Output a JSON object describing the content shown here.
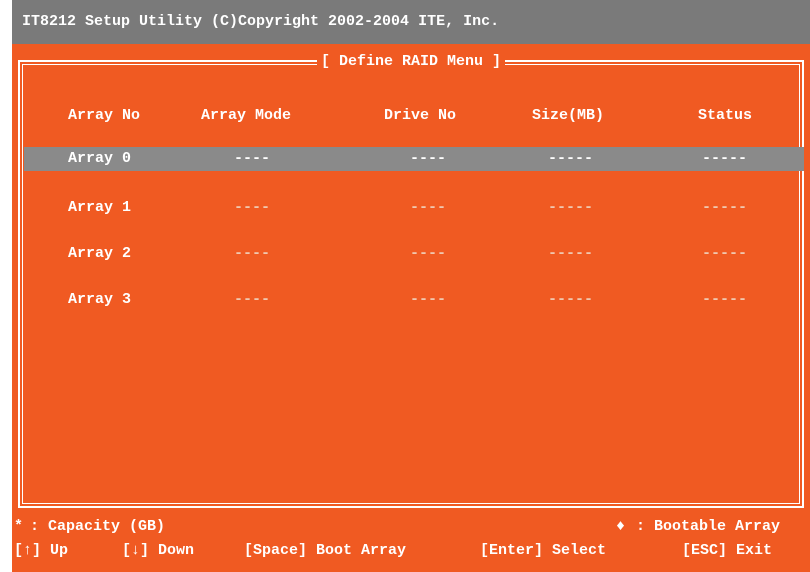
{
  "title_bar": "IT8212 Setup Utility (C)Copyright 2002-2004 ITE, Inc.",
  "menu_title": "[ Define RAID Menu ]",
  "columns": [
    "Array No",
    "Array Mode",
    "Drive No",
    "Size(MB)",
    "Status"
  ],
  "rows": [
    {
      "array_no": "Array 0",
      "mode": "----",
      "drive": "----",
      "size": "-----",
      "status": "-----"
    },
    {
      "array_no": "Array 1",
      "mode": "----",
      "drive": "----",
      "size": "-----",
      "status": "-----"
    },
    {
      "array_no": "Array 2",
      "mode": "----",
      "drive": "----",
      "size": "-----",
      "status": "-----"
    },
    {
      "array_no": "Array 3",
      "mode": "----",
      "drive": "----",
      "size": "-----",
      "status": "-----"
    }
  ],
  "selected_row": 0,
  "legend": {
    "capacity_symbol": "*",
    "capacity_text": ": Capacity (GB)",
    "bootable_symbol": "♦",
    "bootable_text": ": Bootable Array"
  },
  "keys": {
    "up": "[↑] Up",
    "down": "[↓] Down",
    "space": "[Space] Boot Array",
    "enter": "[Enter] Select",
    "esc": "[ESC] Exit"
  },
  "colors": {
    "background": "#f05a22",
    "title_bar": "#7a7a7a",
    "highlight": "#8a8a8a",
    "text": "#ffffff"
  }
}
